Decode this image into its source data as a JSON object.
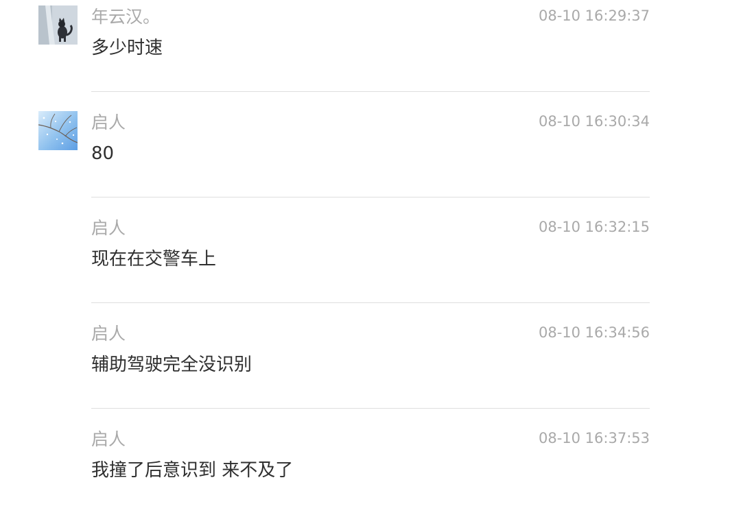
{
  "messages": [
    {
      "sender": "年云汉。",
      "time": "08-10 16:29:37",
      "text": "多少时速",
      "avatar": "cat-avatar"
    },
    {
      "sender": "启人",
      "time": "08-10 16:30:34",
      "text": "80",
      "avatar": "branches-sky-avatar"
    },
    {
      "sender": "启人",
      "time": "08-10 16:32:15",
      "text": "现在在交警车上"
    },
    {
      "sender": "启人",
      "time": "08-10 16:34:56",
      "text": "辅助驾驶完全没识别"
    },
    {
      "sender": "启人",
      "time": "08-10 16:37:53",
      "text": "我撞了后意识到 来不及了"
    }
  ]
}
